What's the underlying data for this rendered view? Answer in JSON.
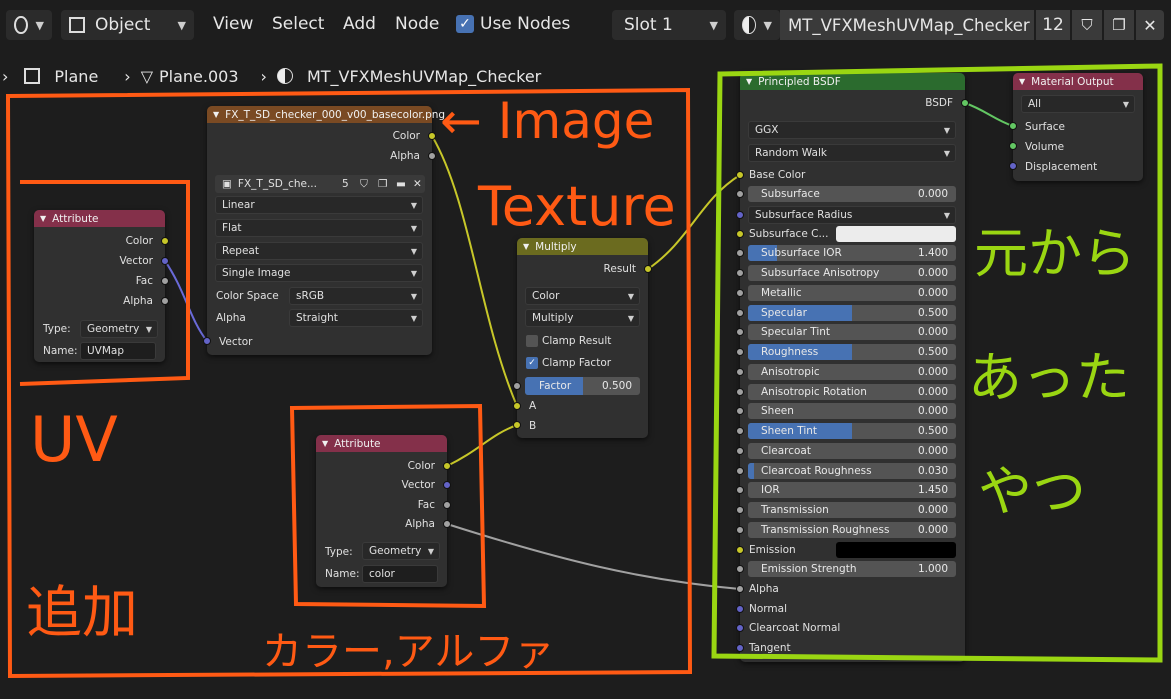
{
  "header": {
    "mode": "Object",
    "menu": [
      "View",
      "Select",
      "Add",
      "Node"
    ],
    "use_nodes": "Use Nodes",
    "slot": "Slot 1",
    "material_name": "MT_VFXMeshUVMap_Checker",
    "user_count": "12"
  },
  "breadcrumb": [
    "Plane",
    "Plane.003",
    "MT_VFXMeshUVMap_Checker"
  ],
  "image_node": {
    "title": "FX_T_SD_checker_000_v00_basecolor.png",
    "out_color": "Color",
    "out_alpha": "Alpha",
    "image_name": "FX_T_SD_che...",
    "image_users": "5",
    "interpolation": "Linear",
    "projection": "Flat",
    "extension": "Repeat",
    "source": "Single Image",
    "color_space_label": "Color Space",
    "color_space": "sRGB",
    "alpha_label": "Alpha",
    "alpha_mode": "Straight",
    "in_vector": "Vector"
  },
  "attr1": {
    "title": "Attribute",
    "outputs": [
      "Color",
      "Vector",
      "Fac",
      "Alpha"
    ],
    "type_label": "Type:",
    "type": "Geometry",
    "name_label": "Name:",
    "name": "UVMap"
  },
  "attr2": {
    "title": "Attribute",
    "outputs": [
      "Color",
      "Vector",
      "Fac",
      "Alpha"
    ],
    "type_label": "Type:",
    "type": "Geometry",
    "name_label": "Name:",
    "name": "color"
  },
  "multiply": {
    "title": "Multiply",
    "result": "Result",
    "data_type": "Color",
    "blend": "Multiply",
    "clamp_result": "Clamp Result",
    "clamp_factor": "Clamp Factor",
    "factor_label": "Factor",
    "factor": "0.500",
    "factor_fraction": 0.5,
    "in_a": "A",
    "in_b": "B"
  },
  "bsdf": {
    "title": "Principled BSDF",
    "out": "BSDF",
    "distribution": "GGX",
    "subsurface_method": "Random Walk",
    "base_color": "Base Color",
    "rows": [
      {
        "label": "Subsurface",
        "value": "0.000",
        "fill": 0
      },
      {
        "label": "Subsurface Radius",
        "dropdown": true
      },
      {
        "label": "Subsurface C...",
        "swatch": "#ececec"
      },
      {
        "label": "Subsurface IOR",
        "value": "1.400",
        "fill": 0.14
      },
      {
        "label": "Subsurface Anisotropy",
        "value": "0.000",
        "fill": 0
      },
      {
        "label": "Metallic",
        "value": "0.000",
        "fill": 0
      },
      {
        "label": "Specular",
        "value": "0.500",
        "fill": 0.5
      },
      {
        "label": "Specular Tint",
        "value": "0.000",
        "fill": 0
      },
      {
        "label": "Roughness",
        "value": "0.500",
        "fill": 0.5
      },
      {
        "label": "Anisotropic",
        "value": "0.000",
        "fill": 0
      },
      {
        "label": "Anisotropic Rotation",
        "value": "0.000",
        "fill": 0
      },
      {
        "label": "Sheen",
        "value": "0.000",
        "fill": 0
      },
      {
        "label": "Sheen Tint",
        "value": "0.500",
        "fill": 0.5
      },
      {
        "label": "Clearcoat",
        "value": "0.000",
        "fill": 0
      },
      {
        "label": "Clearcoat Roughness",
        "value": "0.030",
        "fill": 0.03
      },
      {
        "label": "IOR",
        "value": "1.450",
        "fill": 0
      },
      {
        "label": "Transmission",
        "value": "0.000",
        "fill": 0
      },
      {
        "label": "Transmission Roughness",
        "value": "0.000",
        "fill": 0
      },
      {
        "label": "Emission",
        "swatch": "#000000"
      },
      {
        "label": "Emission Strength",
        "value": "1.000",
        "fill": 0
      }
    ],
    "alpha": "Alpha",
    "normal": "Normal",
    "clearcoat_normal": "Clearcoat Normal",
    "tangent": "Tangent"
  },
  "output_node": {
    "title": "Material Output",
    "target": "All",
    "surface": "Surface",
    "volume": "Volume",
    "displacement": "Displacement"
  },
  "annotations": {
    "image_texture_1": "← Image",
    "image_texture_2": "Texture",
    "uv": "UV",
    "add": "追加",
    "color_alpha": "カラー,アルファ",
    "original_1": "元から",
    "original_2": "あった",
    "original_3": "やつ"
  },
  "colors": {
    "annotation_orange": "#ff5a14",
    "annotation_green": "#9ad612",
    "accent_blue": "#4772b3"
  }
}
